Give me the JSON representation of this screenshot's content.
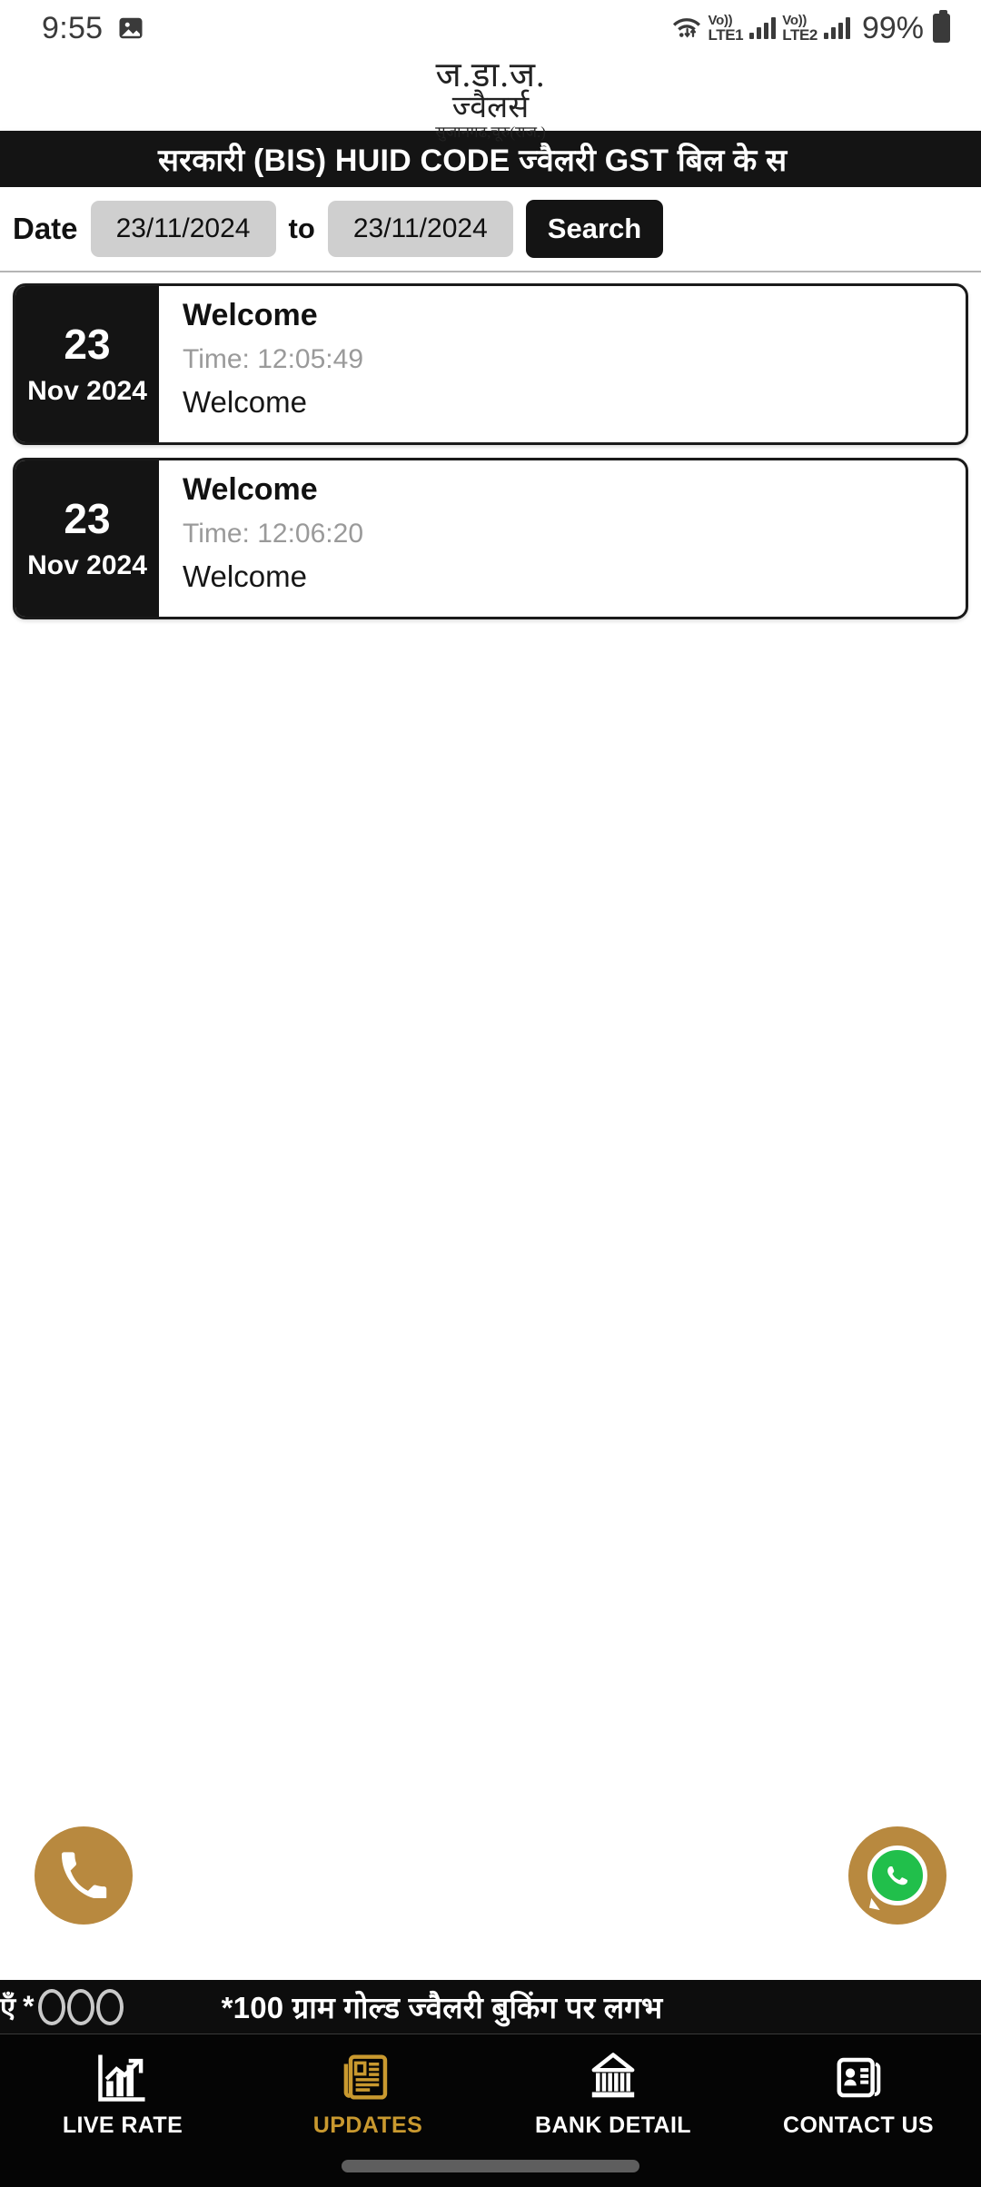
{
  "status_bar": {
    "time": "9:55",
    "photo_icon": "image-icon",
    "wifi_icon": "wifi-icon",
    "sim1_vo": "Vo))",
    "sim1_lte": "LTE1",
    "sim2_vo": "Vo))",
    "sim2_lte": "LTE2",
    "battery_percent": "99%",
    "battery_icon": "battery-full-icon"
  },
  "logo": {
    "line1": "ज.डा.ज.",
    "line2": "ज्वैलर्स",
    "line3": "सुजानगढ,चूरु(राज.)"
  },
  "marquee_top": {
    "text": "सरकारी  (BIS) HUID CODE ज्वैलरी  GST बिल के स"
  },
  "search": {
    "date_label": "Date",
    "from_value": "23/11/2024",
    "to_label": "to",
    "to_value": "23/11/2024",
    "search_label": "Search"
  },
  "cards": [
    {
      "day": "23",
      "month_year": "Nov 2024",
      "title": "Welcome",
      "time": "Time: 12:05:49",
      "message": "Welcome"
    },
    {
      "day": "23",
      "month_year": "Nov 2024",
      "title": "Welcome",
      "time": "Time: 12:06:20",
      "message": "Welcome"
    }
  ],
  "fabs": {
    "call_icon": "phone-icon",
    "whatsapp_icon": "whatsapp-icon",
    "color": "#b8893f"
  },
  "marquee_bottom": {
    "prefix": "एँ",
    "star": "*",
    "text": "*100 ग्राम गोल्ड ज्वैलरी बुकिंग पर लगभ"
  },
  "bottom_nav": {
    "active_color": "#c9992f",
    "items": [
      {
        "label": "LIVE RATE",
        "icon": "chart-growth-icon",
        "active": false
      },
      {
        "label": "UPDATES",
        "icon": "newspaper-icon",
        "active": true
      },
      {
        "label": "BANK DETAIL",
        "icon": "bank-building-icon",
        "active": false
      },
      {
        "label": "CONTACT US",
        "icon": "contact-card-icon",
        "active": false
      }
    ]
  }
}
